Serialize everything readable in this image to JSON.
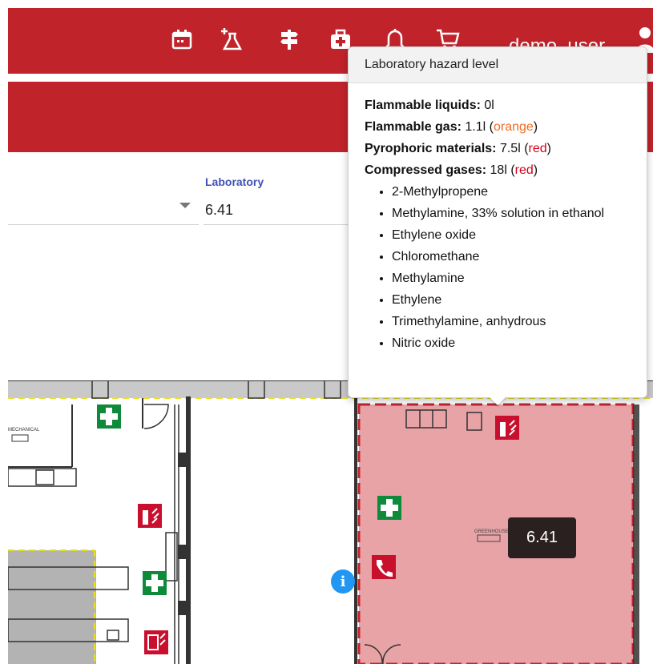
{
  "header": {
    "username": "demo_user",
    "icons": [
      "calendar-icon",
      "flask-add-icon",
      "signpost-icon",
      "first-aid-kit-icon",
      "bell-icon",
      "cart-icon",
      "user-avatar-icon"
    ]
  },
  "form": {
    "laboratory_label": "Laboratory",
    "laboratory_value": "6.41"
  },
  "tooltip": {
    "title": "Laboratory hazard level",
    "flammable_liquids_label": "Flammable liquids:",
    "flammable_liquids_value": "0l",
    "flammable_gas_label": "Flammable gas:",
    "flammable_gas_value": "1.1l",
    "flammable_gas_level": "orange",
    "pyrophoric_label": "Pyrophoric materials:",
    "pyrophoric_value": "7.5l",
    "pyrophoric_level": "red",
    "compressed_label": "Compressed gases:",
    "compressed_value": "18l",
    "compressed_level": "red",
    "gases": [
      "2-Methylpropene",
      "Methylamine, 33% solution in ethanol",
      "Ethylene oxide",
      "Chloromethane",
      "Methylamine",
      "Ethylene",
      "Trimethylamine, anhydrous",
      "Nitric oxide"
    ]
  },
  "map": {
    "room_label": "6.41",
    "room_name_small": "GREENHOUSE",
    "mechanical_label": "MECHANICAL",
    "info_symbol": "i",
    "highlight_color": "#e8a3a6",
    "first_aid_color": "#0f8a3b",
    "fire_color": "#c8102e"
  },
  "colors": {
    "brand_red": "#c1232b",
    "label_blue": "#3f51b5",
    "info_blue": "#2196f3"
  }
}
